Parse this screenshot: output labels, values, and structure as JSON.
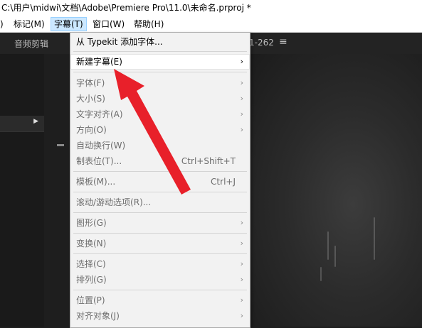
{
  "window": {
    "title": "C:\\用户\\midwi\\文档\\Adobe\\Premiere Pro\\11.0\\未命名.prproj *"
  },
  "menubar": {
    "items": [
      {
        "label": ")"
      },
      {
        "label": "标记(M)"
      },
      {
        "label": "字幕(T)"
      },
      {
        "label": "窗口(W)"
      },
      {
        "label": "帮助(H)"
      }
    ]
  },
  "panel": {
    "tab_label": "音频剪辑",
    "timecode": "1-262",
    "menu_glyph": "≡"
  },
  "dropdown": {
    "items": [
      {
        "label": "从 Typekit 添加字体...",
        "shortcut": "",
        "submenu": false
      },
      {
        "label": "新建字幕(E)",
        "shortcut": "",
        "submenu": true
      },
      {
        "label": "字体(F)",
        "shortcut": "",
        "submenu": true
      },
      {
        "label": "大小(S)",
        "shortcut": "",
        "submenu": true
      },
      {
        "label": "文字对齐(A)",
        "shortcut": "",
        "submenu": true
      },
      {
        "label": "方向(O)",
        "shortcut": "",
        "submenu": true
      },
      {
        "label": "自动换行(W)",
        "shortcut": "",
        "submenu": false
      },
      {
        "label": "制表位(T)...",
        "shortcut": "Ctrl+Shift+T",
        "submenu": false
      },
      {
        "label": "模板(M)...",
        "shortcut": "Ctrl+J",
        "submenu": false
      },
      {
        "label": "滚动/游动选项(R)...",
        "shortcut": "",
        "submenu": false
      },
      {
        "label": "图形(G)",
        "shortcut": "",
        "submenu": true
      },
      {
        "label": "变换(N)",
        "shortcut": "",
        "submenu": true
      },
      {
        "label": "选择(C)",
        "shortcut": "",
        "submenu": true
      },
      {
        "label": "排列(G)",
        "shortcut": "",
        "submenu": true
      },
      {
        "label": "位置(P)",
        "shortcut": "",
        "submenu": true
      },
      {
        "label": "对齐对象(J)",
        "shortcut": "",
        "submenu": true
      }
    ]
  },
  "colors": {
    "annotation_arrow": "#e8202a",
    "menu_highlight": "#cce8ff",
    "dark_bg": "#1e1e1e"
  },
  "icons": {
    "submenu": "chevron-right-icon",
    "left_panel_expand": "triangle-right-icon"
  }
}
